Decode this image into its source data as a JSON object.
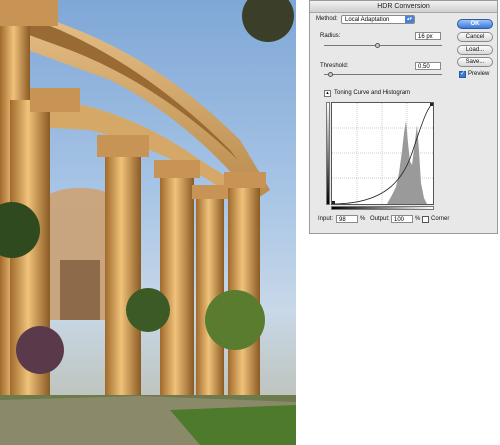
{
  "dialog": {
    "title": "HDR Conversion",
    "method": {
      "label": "Method:",
      "value": "Local Adaptation"
    },
    "radius": {
      "label": "Radius:",
      "value": "16",
      "unit": "px",
      "slider_fraction": 0.45
    },
    "threshold": {
      "label": "Threshold:",
      "value": "0.50",
      "slider_fraction": 0.05
    },
    "toning_section": {
      "label": "Toning Curve and Histogram"
    },
    "input": {
      "label": "Input:",
      "value": "98",
      "unit": "%"
    },
    "output": {
      "label": "Output:",
      "value": "100",
      "unit": "%"
    },
    "corner": {
      "label": "Corner",
      "checked": false
    },
    "buttons": {
      "ok": "OK",
      "cancel": "Cancel",
      "load": "Load...",
      "save": "Save..."
    },
    "preview": {
      "label": "Preview",
      "checked": true
    }
  },
  "colors": {
    "accent": "#3b79d9",
    "dialog_bg": "#e8e8e8",
    "histogram_fill": "#9a9a9a"
  },
  "icons": {
    "method_dropdown": "chevron-updown-icon",
    "section_toggle": "disclosure-triangle-icon"
  }
}
